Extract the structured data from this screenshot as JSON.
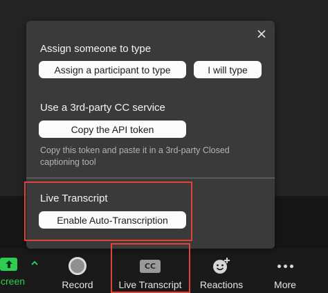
{
  "panel": {
    "assign_title": "Assign someone to type",
    "assign_participant_label": "Assign a participant to type",
    "i_will_type_label": "I will type",
    "third_party_title": "Use a 3rd-party CC service",
    "copy_token_label": "Copy the API token",
    "copy_token_hint": "Copy this token and paste it in a 3rd-party Closed captioning tool",
    "live_transcript_title": "Live Transcript",
    "enable_auto_label": "Enable Auto-Transcription"
  },
  "toolbar": {
    "share_label": "e Screen",
    "record_label": "Record",
    "live_transcript_label": "Live Transcript",
    "cc_text": "CC",
    "reactions_label": "Reactions",
    "more_label": "More"
  },
  "colors": {
    "highlight": "#e0443a",
    "share_green": "#2ecc52",
    "panel_bg": "#3a3a3b"
  }
}
